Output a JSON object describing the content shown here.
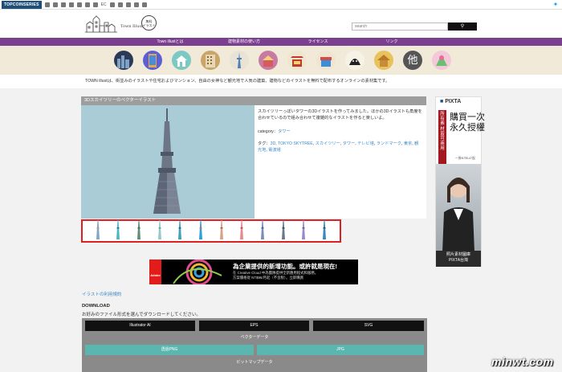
{
  "topbar": {
    "brand": "TOPCOINSERIES",
    "ec": "EC"
  },
  "header": {
    "logo_text": "Town Illust",
    "badge_line1": "無料",
    "badge_line2": "イラスト",
    "search_placeholder": "search"
  },
  "nav": {
    "items": [
      "Town illustとは",
      "建物素材の使い方",
      "ライセンス",
      "リンク"
    ]
  },
  "categories": {
    "items": [
      "city-icon",
      "building-icon",
      "house-icon",
      "apartment-icon",
      "tower-icon",
      "castle-icon",
      "shrine-icon",
      "shop-icon",
      "dome-icon",
      "temple-icon",
      "other-icon",
      "flower-icon"
    ],
    "other_label": "他"
  },
  "intro": "TOWN illustは、街並みのイラストや住宅およびマンション、自由の女神など観光地で人気の建築、建物などのイラストを無料で配布するオンラインの素材集です。",
  "article": {
    "title": "3Dスカイツリーのベクターイラスト",
    "description": "スカイツリーっぽいタワーの3Dイラストを作ってみました。ほかの3Dイラストも角度を合わせているので組み合わせて複雑的なイラストを作ると楽しいよ。",
    "category_label": "category：",
    "category_value": "タワー",
    "tags_label": "タグ：",
    "tags": [
      "3D",
      "TOKYO SKYTREE",
      "スカイツリー",
      "タワー",
      "テレビ塔",
      "ランドマーク",
      "東京",
      "観光地",
      "電波塔"
    ]
  },
  "ad": {
    "brand": "Adobe",
    "line1": "為企業提供的新增功能。或許就是現在!",
    "line2": "在 Creative Cloud 中為團隊提供全新應用程式和服務，",
    "line3": "方案價格從 NT$96/月起（不含稅）。立即購買"
  },
  "side_ad": {
    "logo": "PIXTA",
    "headline1": "購買一次",
    "headline2": "永久授權",
    "red_text": "所有素材皆可商用",
    "sub": "一張NT$147起",
    "bottom1": "照片素材圖庫",
    "bottom2": "PIXTA台灣"
  },
  "download": {
    "terms_link": "イラストの利用規約",
    "title": "DOWNLOAD",
    "subtitle": "お好みのファイル形式を選んでダウンロードしてください。",
    "vector_buttons": [
      "Illustrator AI",
      "EPS",
      "SVG"
    ],
    "vector_label": "ベクターデータ",
    "bitmap_buttons": [
      "透過PNG",
      "JPG"
    ],
    "bitmap_label": "ビットマップデータ"
  },
  "watermark": "minwt.com"
}
